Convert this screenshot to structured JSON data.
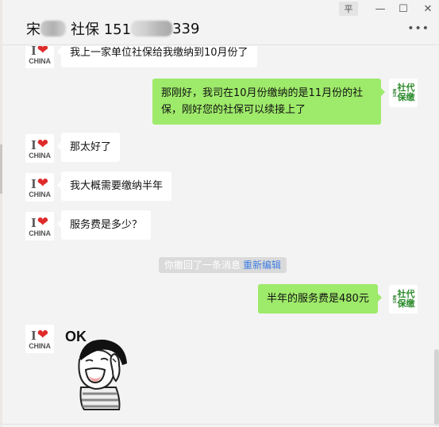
{
  "window": {
    "title_prefix": "宋",
    "title_middle": "社保 151",
    "title_suffix": "339",
    "controls": {
      "pin": "pin-icon",
      "minimize": "minimize-icon",
      "maximize": "maximize-icon",
      "close": "close-icon"
    },
    "more_label": "•••"
  },
  "avatars": {
    "contact": {
      "icon": "i-love-china-avatar",
      "letter": "I",
      "heart": "❤",
      "text": "CHINA"
    },
    "self": {
      "icon": "shebao-daijiao-avatar",
      "small": "武汉",
      "line1": "社代",
      "line2": "保缴"
    }
  },
  "messages": [
    {
      "side": "in",
      "text": "我上一家单位社保给我缴纳到10月份了"
    },
    {
      "side": "out",
      "text": "那刚好，我司在10月份缴纳的是11月份的社保，刚好您的社保可以续接上了"
    },
    {
      "side": "in",
      "text": "那太好了"
    },
    {
      "side": "in",
      "text": "我大概需要缴纳半年"
    },
    {
      "side": "in",
      "text": "服务费是多少？"
    },
    {
      "side": "system",
      "text": "你撤回了一条消息",
      "action": "重新编辑"
    },
    {
      "side": "out",
      "text": "半年的服务费是480元"
    },
    {
      "side": "in",
      "type": "sticker",
      "sticker_text": "OK"
    }
  ],
  "colors": {
    "out_bubble": "#9eea6a",
    "in_bubble": "#ffffff",
    "background": "#f3f3f3",
    "link": "#3f7de3"
  }
}
